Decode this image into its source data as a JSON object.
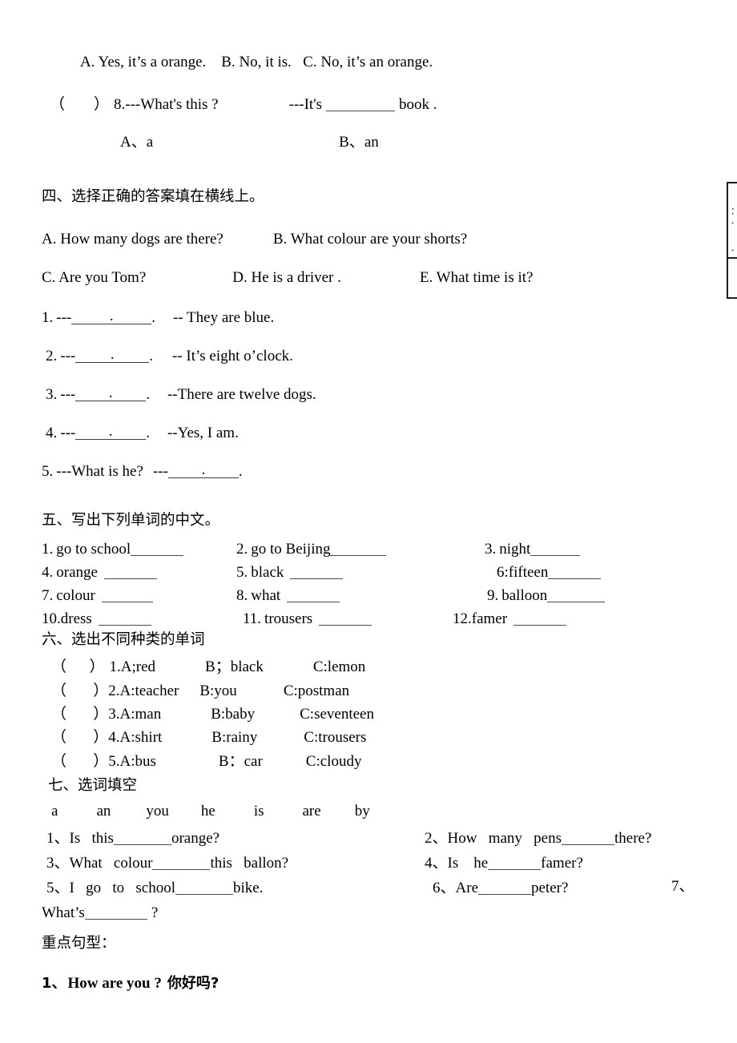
{
  "document": {
    "type": "worksheet",
    "language": "zh-en",
    "background_color": "#ffffff",
    "text_color": "#000000"
  },
  "section_three_tail": {
    "options_line": "A. Yes, it’s a orange.    B. No, it is.   C. No, it’s an orange.",
    "question8": {
      "bracket_open": "（",
      "bracket_close": "）",
      "number": "8.",
      "prompt": "---What's this ?",
      "answer_prefix": "---It's",
      "answer_suffix": "book .",
      "choice_a": "A、a",
      "choice_b": "B、an"
    }
  },
  "section_four": {
    "heading": "四、选择正确的答案填在横线上。",
    "choices_row1": [
      "A. How many dogs are there?",
      "B. What colour are your shorts?"
    ],
    "choices_row2": [
      "C. Are you Tom?",
      "D. He is a driver .",
      "E. What time is it?"
    ],
    "items": [
      {
        "number": "1.",
        "lead": "---",
        "tail": ".",
        "answer": "-- They are blue."
      },
      {
        "number": "2.",
        "lead": "---",
        "tail": ".",
        "answer": "-- It’s eight o’clock."
      },
      {
        "number": "3.",
        "lead": "---",
        "tail": ".",
        "answer": "--There are twelve dogs."
      },
      {
        "number": "4.",
        "lead": "---",
        "tail": ".",
        "answer": "--Yes, I am."
      }
    ],
    "item5": {
      "number": "5.",
      "question": "---What is he?",
      "lead": "---",
      "tail": "."
    }
  },
  "section_five": {
    "heading": "五、写出下列单词的中文。",
    "words": [
      {
        "number": "1.",
        "word": "go to school"
      },
      {
        "number": "2.",
        "word": "go to Beijing"
      },
      {
        "number": "3.",
        "word": "night"
      },
      {
        "number": "4.",
        "word": "orange"
      },
      {
        "number": "5.",
        "word": "black"
      },
      {
        "number": "6:",
        "word": "fifteen"
      },
      {
        "number": "7.",
        "word": "colour"
      },
      {
        "number": "8.",
        "word": "what"
      },
      {
        "number": "9.",
        "word": "balloon"
      },
      {
        "number": "10.",
        "word": "dress"
      },
      {
        "number": "11.",
        "word": "trousers"
      },
      {
        "number": "12.",
        "word": "famer"
      }
    ]
  },
  "section_six": {
    "heading": "六、选出不同种类的单词",
    "items": [
      {
        "bracket": "（      ）",
        "num": "1.",
        "a": "A;red",
        "b": "B；black",
        "c": "C:lemon"
      },
      {
        "bracket": "（       ）",
        "num": "2.",
        "a": "A:teacher",
        "b": "B:you",
        "c": "C:postman"
      },
      {
        "bracket": "（       ）",
        "num": "3.",
        "a": "A:man",
        "b": "B:baby",
        "c": "C:seventeen"
      },
      {
        "bracket": "（       ）",
        "num": "4.",
        "a": "A:shirt",
        "b": "B:rainy",
        "c": "C:trousers"
      },
      {
        "bracket": "（       ）",
        "num": "5.",
        "a": "A:bus",
        "b": "B：car",
        "c": "C:cloudy"
      }
    ]
  },
  "section_seven": {
    "heading": "七、选词填空",
    "word_bank": [
      "a",
      "an",
      "you",
      "he",
      "is",
      "are",
      "by"
    ],
    "items": [
      {
        "number": "1、",
        "before": "Is   this",
        "after": "orange?"
      },
      {
        "number": "2、",
        "before": "How   many   pens",
        "after": "there?"
      },
      {
        "number": "3、",
        "before": "What   colour",
        "after": "this   ballon?"
      },
      {
        "number": "4、",
        "before": "Is    he",
        "after": "famer?"
      },
      {
        "number": "5、",
        "before": "I   go   to   school",
        "after": "bike."
      },
      {
        "number": "6、",
        "before": "Are",
        "after": "peter?"
      },
      {
        "number": "7、",
        "before": "What’s",
        "after": "?"
      }
    ]
  },
  "section_key_sentences": {
    "heading": "重点句型：",
    "items": [
      {
        "number": "1、",
        "english": "How are you ?",
        "chinese": "你好吗?"
      }
    ]
  },
  "edge_box": {
    "visible": true,
    "note": "partially clipped bordered box at right page margin",
    "border_color": "#1a1a2e",
    "fragments": [
      "：",
      "．",
      "．"
    ]
  }
}
